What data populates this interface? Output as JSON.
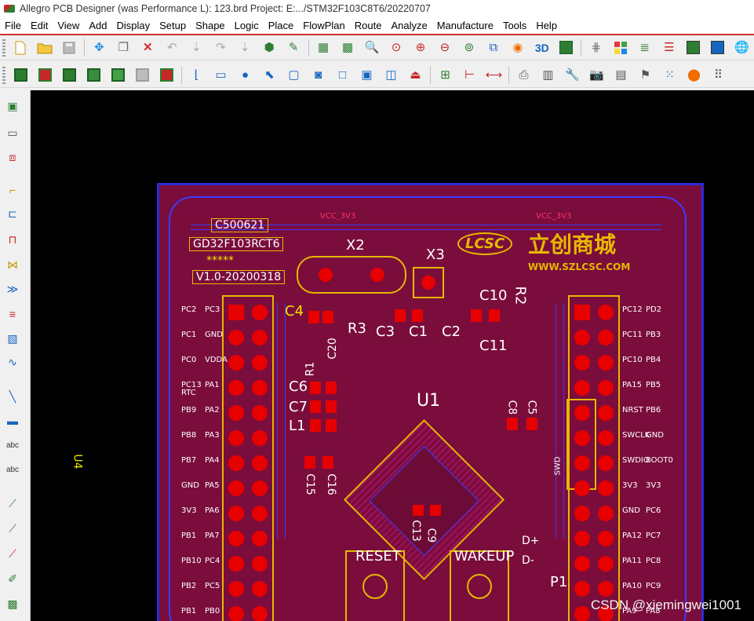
{
  "window": {
    "title": "Allegro PCB Designer (was Performance L): 123.brd  Project: E:.../STM32F103C8T6/20220707"
  },
  "menu": [
    {
      "label": "File"
    },
    {
      "label": "Edit"
    },
    {
      "label": "View"
    },
    {
      "label": "Add"
    },
    {
      "label": "Display"
    },
    {
      "label": "Setup"
    },
    {
      "label": "Shape"
    },
    {
      "label": "Logic"
    },
    {
      "label": "Place"
    },
    {
      "label": "FlowPlan"
    },
    {
      "label": "Route"
    },
    {
      "label": "Analyze"
    },
    {
      "label": "Manufacture"
    },
    {
      "label": "Tools"
    },
    {
      "label": "Help"
    }
  ],
  "toolbar1": {
    "icons": [
      "new-file-icon",
      "open-folder-icon",
      "save-icon",
      "move-icon",
      "copy-icon",
      "delete-icon",
      "undo-icon",
      "undo-down-icon",
      "redo-icon",
      "redo-down-icon",
      "shape-icon",
      "pin-icon",
      "grid-icon",
      "grid-fit-icon",
      "zoom-fit-icon",
      "zoom-points-icon",
      "zoom-in-icon",
      "zoom-out-icon",
      "zoom-world-icon",
      "zoom-previous-icon",
      "refresh-icon",
      "3d-view-icon",
      "flip-icon",
      "grid-dots-icon",
      "color-icon",
      "layers-icon",
      "stack-icon",
      "ecm-icon",
      "dfa-icon",
      "web-icon"
    ]
  },
  "toolbar2": {
    "icons": [
      "board-layer-1-icon",
      "board-layer-2-icon",
      "board-layer-3-icon",
      "board-layer-4-icon",
      "board-layer-5-icon",
      "board-layer-6-icon",
      "board-layer-7-icon",
      "corner-icon",
      "rect-icon",
      "circle-icon",
      "select-icon",
      "rounded-rect-icon",
      "arc-icon",
      "square-icon",
      "square-round-icon",
      "frame-icon",
      "stamp-icon",
      "component-icon",
      "dimension-icon",
      "measure-icon",
      "odb-icon",
      "book-icon",
      "wrench-icon",
      "camera-icon",
      "report-icon",
      "flag-icon",
      "dots-icon",
      "tag-icon",
      "grid-small-icon"
    ]
  },
  "sidebar": {
    "icons": [
      "place-component-icon",
      "place-part-icon",
      "place-connector-icon",
      "add-connect-icon",
      "slide-icon",
      "delay-tune-icon",
      "custom-smooth-icon",
      "vertex-icon",
      "spread-icon",
      "shield-icon",
      "add-line-icon",
      "add-rect-icon",
      "add-text-icon",
      "edit-text-icon",
      "route-1-icon",
      "route-2-icon",
      "route-3-icon",
      "route-4-icon",
      "route-5-icon"
    ]
  },
  "board": {
    "silk": {
      "part_no": "C500621",
      "mcu_name": "GD32F103RCT6",
      "stars": "*****",
      "version": "V1.0-20200318",
      "vcc_left": "VCC_3V3",
      "vcc_right": "VCC_3V3",
      "logo_text": "立创商城",
      "logo_url": "WWW.SZLCSC.COM",
      "logo_mark": "LCSC",
      "x2": "X2",
      "x3": "X3",
      "c4": "C4",
      "r3": "R3",
      "c3": "C3",
      "c1": "C1",
      "c2": "C2",
      "c10": "C10",
      "r2": "R2",
      "c11": "C11",
      "c20": "C20",
      "r1": "R1",
      "c6": "C6",
      "c7": "C7",
      "l1": "L1",
      "u1": "U1",
      "c8": "C8",
      "c5": "C5",
      "c15": "C15",
      "c16": "C16",
      "c13": "C13",
      "c9": "C9",
      "swd": "SWD",
      "reset": "RESET",
      "wakeup": "WAKEUP",
      "p1": "P1",
      "d_plus": "D+",
      "d_minus": "D-",
      "u4": "U4"
    },
    "left_header_pins": [
      [
        "PC2",
        "PC3"
      ],
      [
        "PC1",
        "GND"
      ],
      [
        "PC0",
        "VDDA"
      ],
      [
        "PC13 RTC",
        "PA1"
      ],
      [
        "PB9",
        "PA2"
      ],
      [
        "PB8",
        "PA3"
      ],
      [
        "PB7",
        "PA4"
      ],
      [
        "GND",
        "PA5"
      ],
      [
        "3V3",
        "PA6"
      ],
      [
        "PB1",
        "PA7"
      ],
      [
        "PB10",
        "PC4"
      ],
      [
        "PB2",
        "PC5"
      ],
      [
        "PB1",
        "PB0"
      ]
    ],
    "right_header_pins": [
      [
        "PC12",
        "PD2"
      ],
      [
        "PC11",
        "PB3"
      ],
      [
        "PC10",
        "PB4"
      ],
      [
        "PA15",
        "PB5"
      ],
      [
        "NRST",
        "PB6"
      ],
      [
        "SWCLK",
        "GND"
      ],
      [
        "SWDIO",
        "BOOT0"
      ],
      [
        "3V3",
        "3V3"
      ],
      [
        "GND",
        "PC6"
      ],
      [
        "PA12",
        "PC7"
      ],
      [
        "PA11",
        "PC8"
      ],
      [
        "PA10",
        "PC9"
      ],
      [
        "PA9",
        "PA8"
      ]
    ]
  },
  "watermark": "CSDN @xiemingwei1001"
}
